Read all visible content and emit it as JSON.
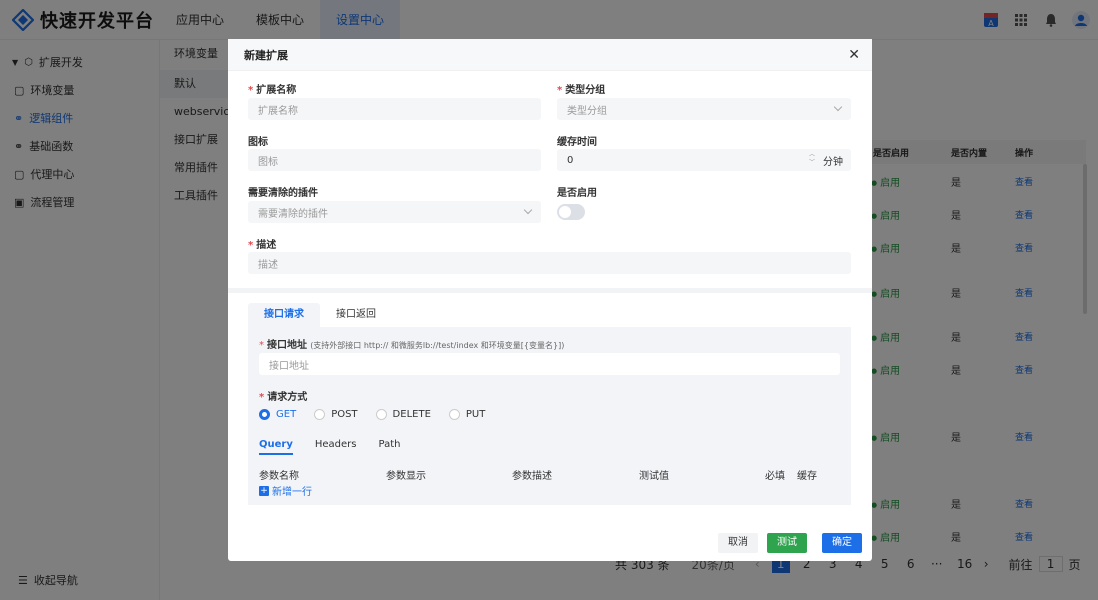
{
  "brand": {
    "title": "快速开发平台"
  },
  "topnav": [
    {
      "label": "应用中心"
    },
    {
      "label": "模板中心"
    },
    {
      "label": "设置中心"
    }
  ],
  "sidebar": {
    "group": "扩展开发",
    "items": [
      {
        "label": "环境变量"
      },
      {
        "label": "逻辑组件"
      },
      {
        "label": "基础函数"
      },
      {
        "label": "代理中心"
      },
      {
        "label": "流程管理"
      }
    ],
    "footer": "收起导航"
  },
  "col2": {
    "header": "环境变量",
    "items": [
      {
        "label": "默认"
      },
      {
        "label": "webservice"
      },
      {
        "label": "接口扩展"
      },
      {
        "label": "常用插件"
      },
      {
        "label": "工具插件"
      }
    ]
  },
  "table": {
    "headers": {
      "enabled": "是否启用",
      "builtin": "是否内置",
      "actions": "操作"
    },
    "rows": [
      {
        "status": "启用",
        "builtin": "是",
        "action": "查看"
      },
      {
        "status": "启用",
        "builtin": "是",
        "action": "查看"
      },
      {
        "status": "启用",
        "builtin": "是",
        "action": "查看"
      },
      {
        "status": "启用",
        "builtin": "是",
        "action": "查看"
      },
      {
        "status": "启用",
        "builtin": "是",
        "action": "查看"
      },
      {
        "status": "启用",
        "builtin": "是",
        "action": "查看"
      },
      {
        "status": "启用",
        "builtin": "是",
        "action": "查看"
      },
      {
        "status": "启用",
        "builtin": "是",
        "action": "查看"
      },
      {
        "status": "启用",
        "builtin": "是",
        "action": "查看"
      }
    ]
  },
  "pager": {
    "total": "共 303 条",
    "size": "20条/页",
    "pages": [
      "1",
      "2",
      "3",
      "4",
      "5",
      "6",
      "···",
      "16"
    ],
    "goto": "前往",
    "goto_value": "1",
    "page_unit": "页"
  },
  "modal": {
    "title": "新建扩展",
    "close": "✕",
    "fields": {
      "name_label": "扩展名称",
      "name_placeholder": "扩展名称",
      "type_label": "类型分组",
      "type_placeholder": "类型分组",
      "icon_label": "图标",
      "icon_placeholder": "图标",
      "cache_label": "缓存时间",
      "cache_value": "0",
      "cache_unit": "分钟",
      "plugins_label": "需要清除的插件",
      "plugins_placeholder": "需要清除的插件",
      "enabled_label": "是否启用",
      "enabled_value": false,
      "desc_label": "描述",
      "desc_placeholder": "描述"
    },
    "tabs": [
      {
        "label": "接口请求"
      },
      {
        "label": "接口返回"
      }
    ],
    "request": {
      "url_label": "接口地址",
      "url_hint": "(支持外部接口 http:// 和微服务lb://test/index 和环境变量[{变量名}])",
      "url_placeholder": "接口地址",
      "method_label": "请求方式",
      "methods": [
        {
          "label": "GET",
          "selected": true
        },
        {
          "label": "POST",
          "selected": false
        },
        {
          "label": "DELETE",
          "selected": false
        },
        {
          "label": "PUT",
          "selected": false
        }
      ],
      "subtabs": [
        {
          "label": "Query"
        },
        {
          "label": "Headers"
        },
        {
          "label": "Path"
        }
      ],
      "param_columns": [
        "参数名称",
        "参数显示",
        "参数描述",
        "测试值",
        "必填",
        "缓存"
      ],
      "add_row": "新增一行"
    },
    "buttons": {
      "cancel": "取消",
      "test": "测试",
      "ok": "确定"
    }
  },
  "colors": {
    "primary": "#1d6fe8",
    "success": "#2ea44f",
    "danger": "#e5484d"
  }
}
